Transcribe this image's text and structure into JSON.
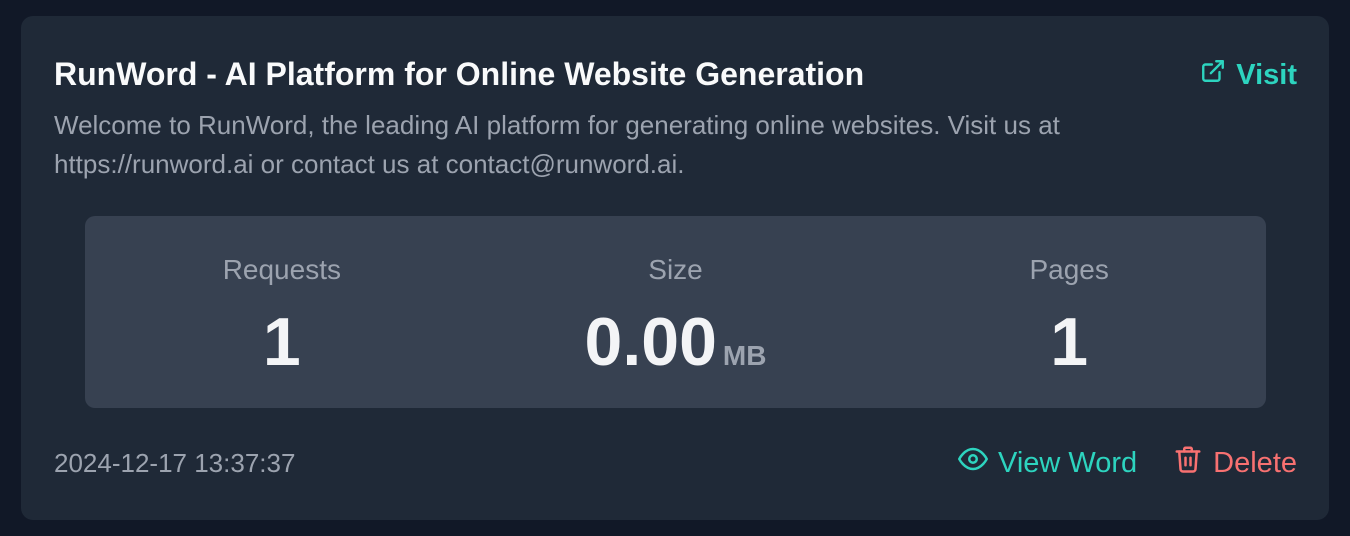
{
  "card": {
    "title": "RunWord - AI Platform for Online Website Generation",
    "visit_label": "Visit",
    "description": "Welcome to RunWord, the leading AI platform for generating online websites. Visit us at https://runword.ai or contact us at contact@runword.ai.",
    "stats": [
      {
        "label": "Requests",
        "value": "1",
        "unit": ""
      },
      {
        "label": "Size",
        "value": "0.00",
        "unit": "MB"
      },
      {
        "label": "Pages",
        "value": "1",
        "unit": ""
      }
    ],
    "timestamp": "2024-12-17 13:37:37",
    "view_label": "View Word",
    "delete_label": "Delete"
  },
  "colors": {
    "accent": "#2dd4bf",
    "danger": "#f87171",
    "card_bg": "#1f2937",
    "stats_bg": "#374151"
  },
  "icons": {
    "visit": "external-link-icon",
    "view": "eye-icon",
    "delete": "trash-icon"
  }
}
